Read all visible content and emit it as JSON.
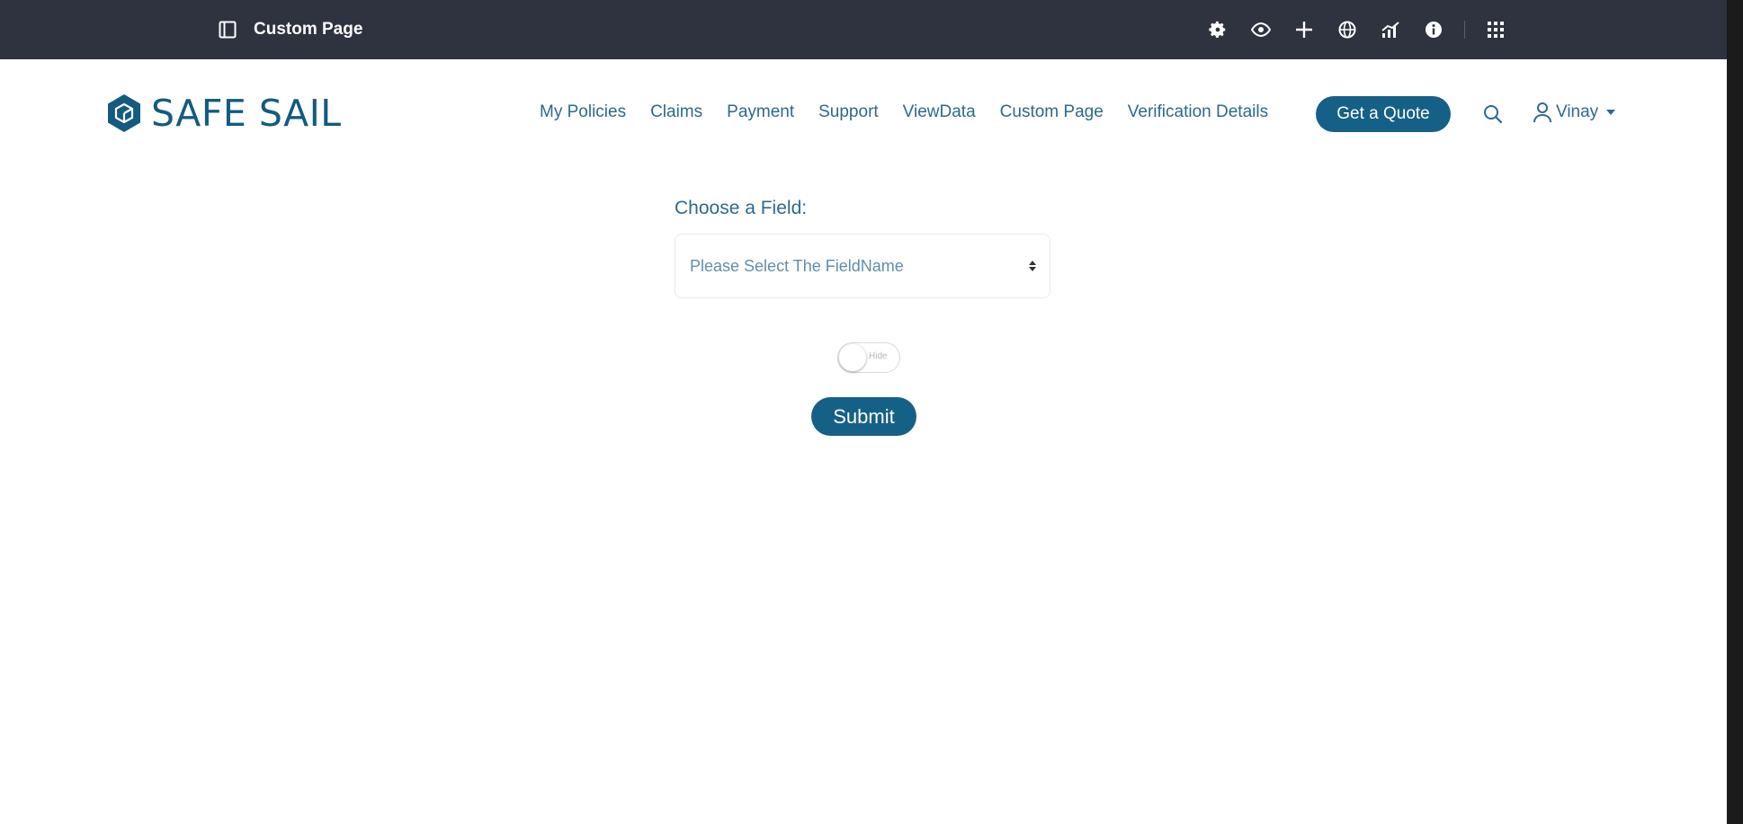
{
  "admin_bar": {
    "title": "Custom Page",
    "tools": [
      "gear-icon",
      "eye-icon",
      "plus-icon",
      "globe-icon",
      "analytics-icon",
      "info-icon",
      "apps-grid-icon"
    ]
  },
  "header": {
    "logo_text": "SAFE SAIL",
    "nav": [
      "My Policies",
      "Claims",
      "Payment",
      "Support",
      "ViewData",
      "Custom Page",
      "Verification Details"
    ],
    "quote_button": "Get a Quote",
    "user_name": "Vinay"
  },
  "form": {
    "label": "Choose a Field:",
    "select_value": "Please Select The FieldName",
    "toggle_label": "Hide",
    "submit_label": "Submit"
  },
  "colors": {
    "admin_bar": "#2f323f",
    "brand": "#135b80",
    "button": "#156087",
    "link": "#2b6a8e"
  }
}
